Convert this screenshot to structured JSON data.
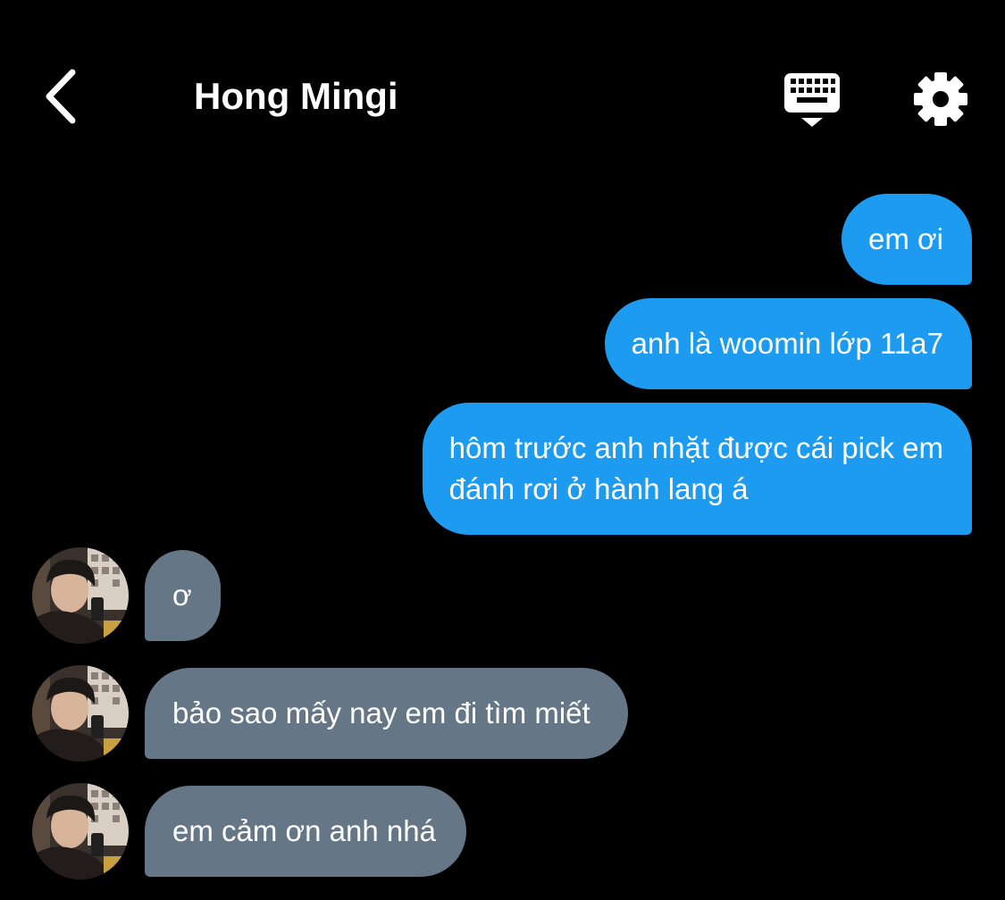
{
  "header": {
    "title": "Hong Mingi",
    "back_icon": "chevron-left-icon",
    "keyboard_icon": "keyboard-icon",
    "settings_icon": "gear-icon"
  },
  "colors": {
    "background": "#000000",
    "outgoing_bubble": "#1d9bf0",
    "incoming_bubble": "#657786",
    "text": "#ffffff"
  },
  "messages": {
    "outgoing": [
      {
        "lines": [
          "em ơi"
        ]
      },
      {
        "lines": [
          "anh là woomin lớp 11a7"
        ]
      },
      {
        "lines": [
          "hôm trước anh nhặt được cái pick em",
          "đánh rơi ở hành lang á"
        ]
      }
    ],
    "incoming": [
      {
        "text": "ơ",
        "avatar": "contact-avatar"
      },
      {
        "text": "bảo sao mấy nay em đi tìm miết",
        "avatar": "contact-avatar"
      },
      {
        "text": "em cảm ơn anh nhá",
        "avatar": "contact-avatar"
      }
    ]
  }
}
